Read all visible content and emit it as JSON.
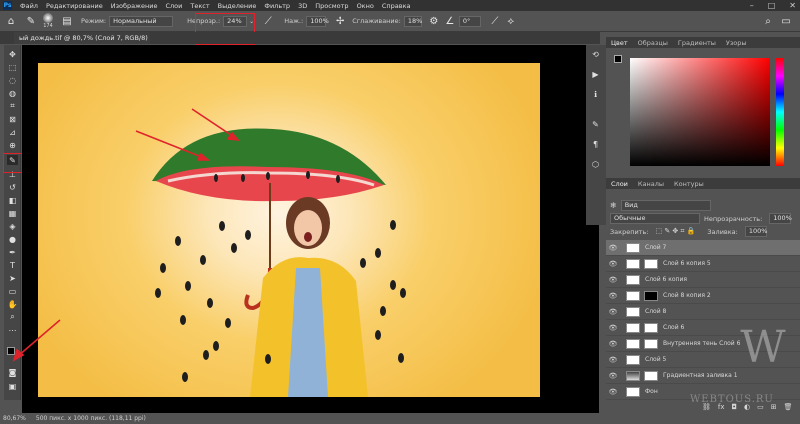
{
  "menu": {
    "logo": "Ps",
    "items": [
      "Файл",
      "Редактирование",
      "Изображение",
      "Слои",
      "Текст",
      "Выделение",
      "Фильтр",
      "3D",
      "Просмотр",
      "Окно",
      "Справка"
    ],
    "window_controls": [
      "–",
      "□",
      "✕"
    ]
  },
  "options": {
    "brush_size": "174",
    "mode_label": "Режим:",
    "mode_value": "Нормальный",
    "opacity_label": "Непрозр.:",
    "opacity_value": "24%",
    "flow_label": "Наж.:",
    "flow_value": "100%",
    "smoothing_label": "Сглаживание:",
    "smoothing_value": "18%",
    "angle_value": "0°"
  },
  "document": {
    "tab_title": "ый дождь.tif @ 80,7% (Слой 7, RGB/8) *",
    "tab_close": "×"
  },
  "status": {
    "zoom": "80,67%",
    "size": "500 пикс. x 1000 пикс. (118,11 ppi)"
  },
  "color_panel": {
    "tabs": [
      "Цвет",
      "Образцы",
      "Градиенты",
      "Узоры"
    ]
  },
  "layers_panel": {
    "tabs": [
      "Слои",
      "Каналы",
      "Контуры"
    ],
    "search_label": "Вид",
    "blend_mode": "Обычные",
    "opacity_label": "Непрозрачность:",
    "opacity_value": "100%",
    "lock_label": "Закрепить:",
    "fill_label": "Заливка:",
    "fill_value": "100%",
    "layers": [
      {
        "name": "Слой 7",
        "selected": true
      },
      {
        "name": "Слой 6 копия 5",
        "selected": false
      },
      {
        "name": "Слой 6 копия",
        "selected": false
      },
      {
        "name": "Слой 8 копия 2",
        "selected": false
      },
      {
        "name": "Слой 8",
        "selected": false
      },
      {
        "name": "Слой 6",
        "selected": false
      },
      {
        "name": "Внутренняя тень Слой 6",
        "selected": false
      },
      {
        "name": "Слой 5",
        "selected": false
      },
      {
        "name": "Градиентная заливка 1",
        "selected": false
      },
      {
        "name": "Фон",
        "selected": false
      }
    ],
    "footer_icons": [
      "link-icon",
      "fx-icon",
      "mask-icon",
      "adjustment-icon",
      "folder-icon",
      "new-layer-icon",
      "trash-icon"
    ]
  },
  "watermark": {
    "letter": "W",
    "text": "WEBTOUS.RU"
  },
  "colors": {
    "annotation_red": "#e0232b",
    "canvas_yellow": "#f4be46",
    "panel_gray": "#535353"
  }
}
